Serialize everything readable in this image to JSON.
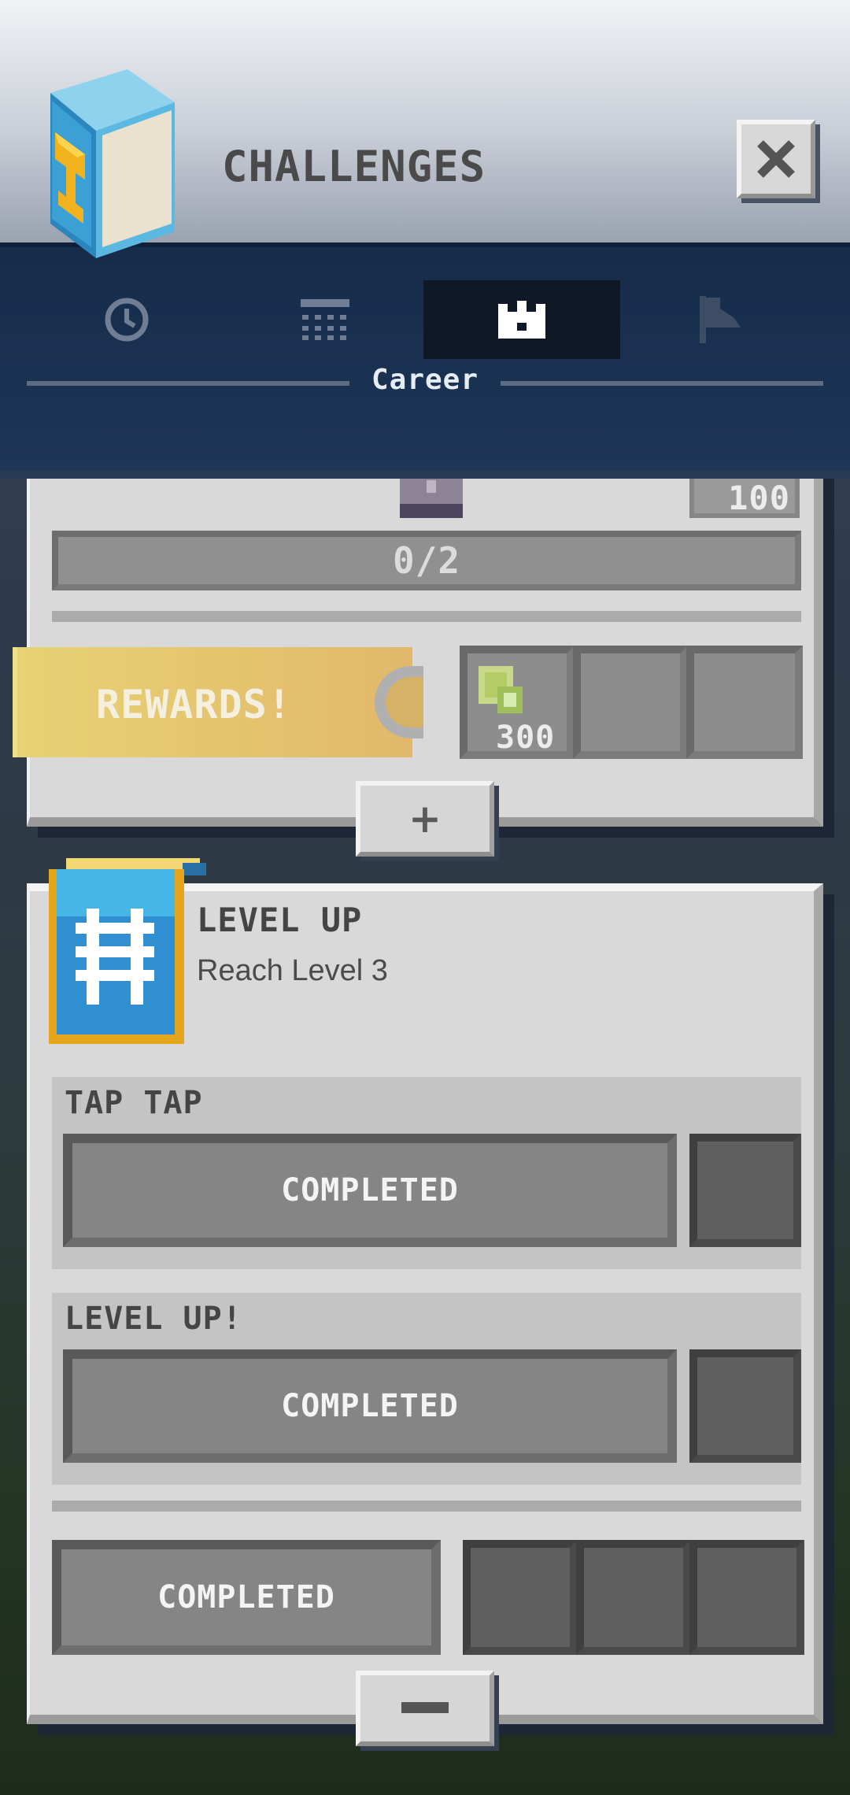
{
  "header": {
    "title": "CHALLENGES",
    "close_label": "×"
  },
  "tabs": [
    {
      "icon": "clock-icon",
      "active": false
    },
    {
      "icon": "calendar-icon",
      "active": false
    },
    {
      "icon": "crown-icon",
      "active": true
    },
    {
      "icon": "flag-icon",
      "active": false
    }
  ],
  "active_tab_label": "Career",
  "challenge_1": {
    "reward_amount": "100",
    "progress_text": "0/2",
    "rewards_label": "REWARDS!",
    "reward_slot_amount": "300",
    "expand_label": "+"
  },
  "challenge_2": {
    "title": "LEVEL UP",
    "description": "Reach Level 3",
    "tasks": [
      {
        "name": "TAP TAP",
        "status": "COMPLETED"
      },
      {
        "name": "LEVEL UP!",
        "status": "COMPLETED"
      }
    ],
    "rewards_status": "COMPLETED",
    "collapse_label": "−"
  },
  "colors": {
    "accent_gold": "#e2b86a",
    "tab_bg": "#172b4a",
    "panel_bg": "#d9d9d9"
  }
}
